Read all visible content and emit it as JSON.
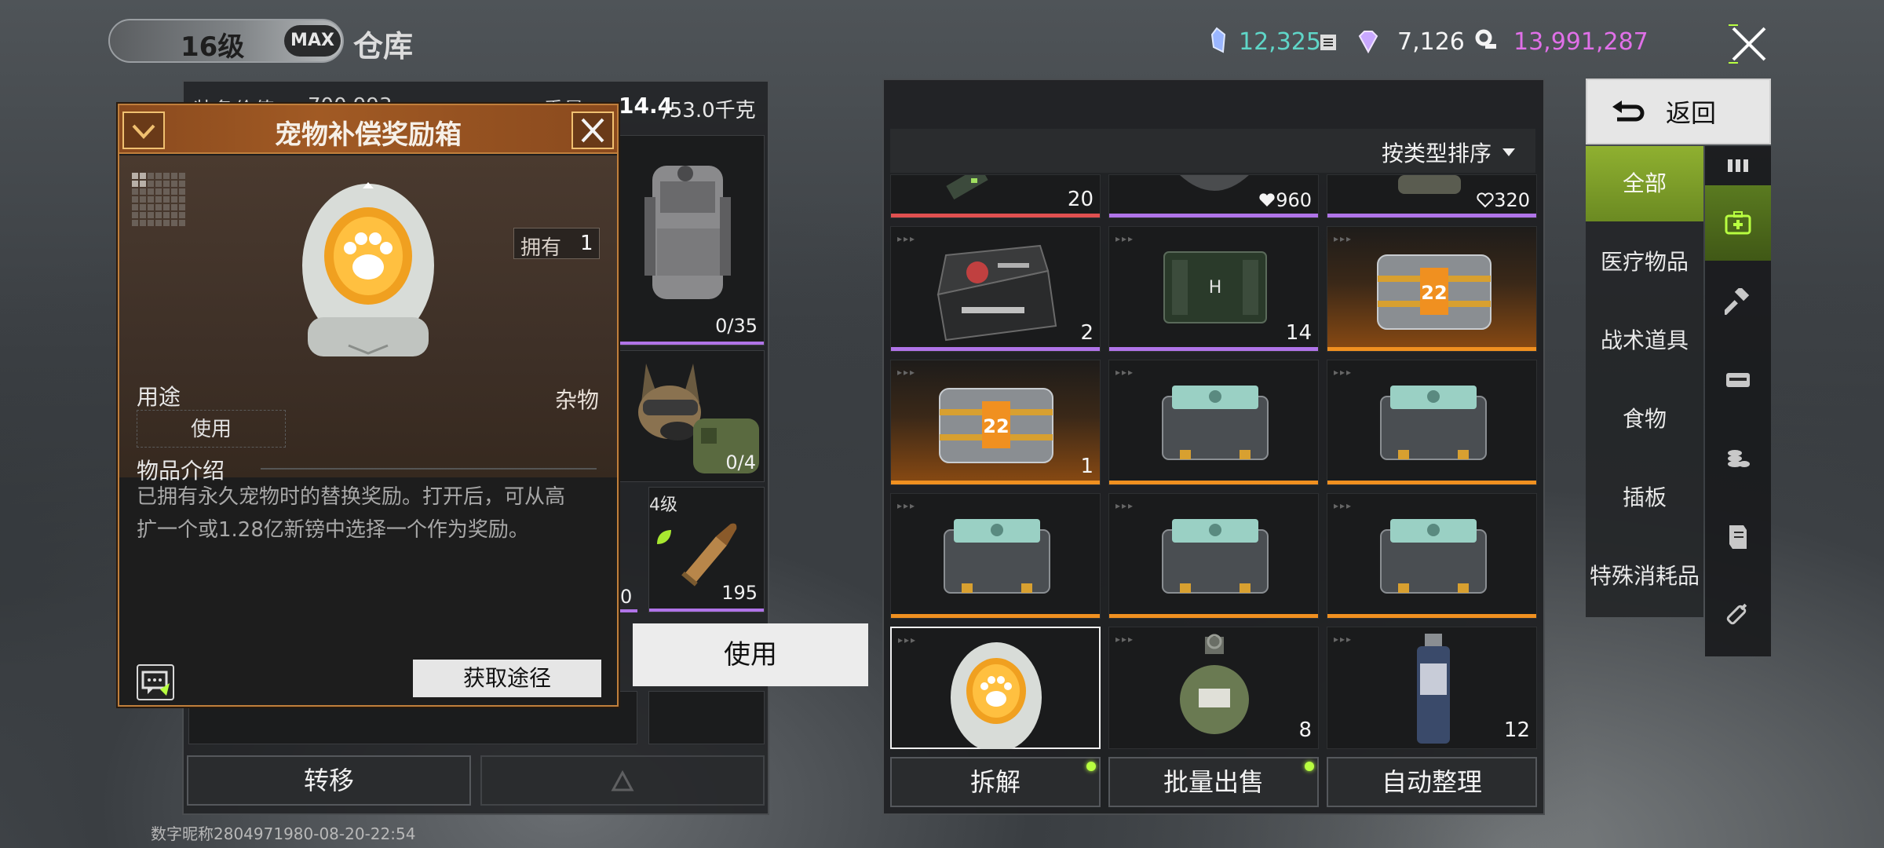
{
  "header": {
    "level": "16级",
    "max_badge": "MAX",
    "title": "仓库",
    "currency_1": "12,325",
    "currency_2": "7,126",
    "currency_3": "13,991,287"
  },
  "left_panel": {
    "value_label": "装备价值：",
    "value": "700,993",
    "weight_label": "重量：",
    "weight_current": "14.4",
    "weight_max": "/53.0千克",
    "backpack_capacity": "0/35",
    "dog_capacity": "0/4",
    "ammo_level": "4级",
    "ammo_count": "195",
    "partial_count": "0",
    "transfer_button": "转移"
  },
  "popup": {
    "title": "宠物补偿奖励箱",
    "own_label": "拥有",
    "own_count": "1",
    "category": "杂物",
    "usage_label": "用途",
    "usage_value": "使用",
    "desc_label": "物品介绍",
    "desc_line1": "已拥有永久宠物时的替换奖励。打开后，可从高",
    "desc_line2": "扩一个或1.28亿新镑中选择一个作为奖励。",
    "source_button": "获取途径"
  },
  "use_button": "使用",
  "footer_id": "数字昵称2804971980-08-20-22:54",
  "right_panel": {
    "sort_label": "按类型排序",
    "row0": [
      "20",
      "960",
      "320"
    ],
    "row1": [
      "2",
      "14",
      ""
    ],
    "row2": [
      "1",
      "",
      ""
    ],
    "row4": [
      "",
      "8",
      "12"
    ],
    "crate_label": "22",
    "dismantle_button": "拆解",
    "bulk_sell_button": "批量出售",
    "auto_sort_button": "自动整理"
  },
  "sidebar": {
    "back_label": "返回",
    "categories": [
      "全部",
      "医疗物品",
      "战术道具",
      "食物",
      "插板",
      "特殊消耗品"
    ]
  },
  "colors": {
    "accent_green": "#8fb030",
    "rarity_orange": "#f09020",
    "rarity_purple": "#b074e8",
    "rarity_red": "#e05050",
    "currency_1_color": "#5fd6c8",
    "currency_3_color": "#e070e8"
  }
}
